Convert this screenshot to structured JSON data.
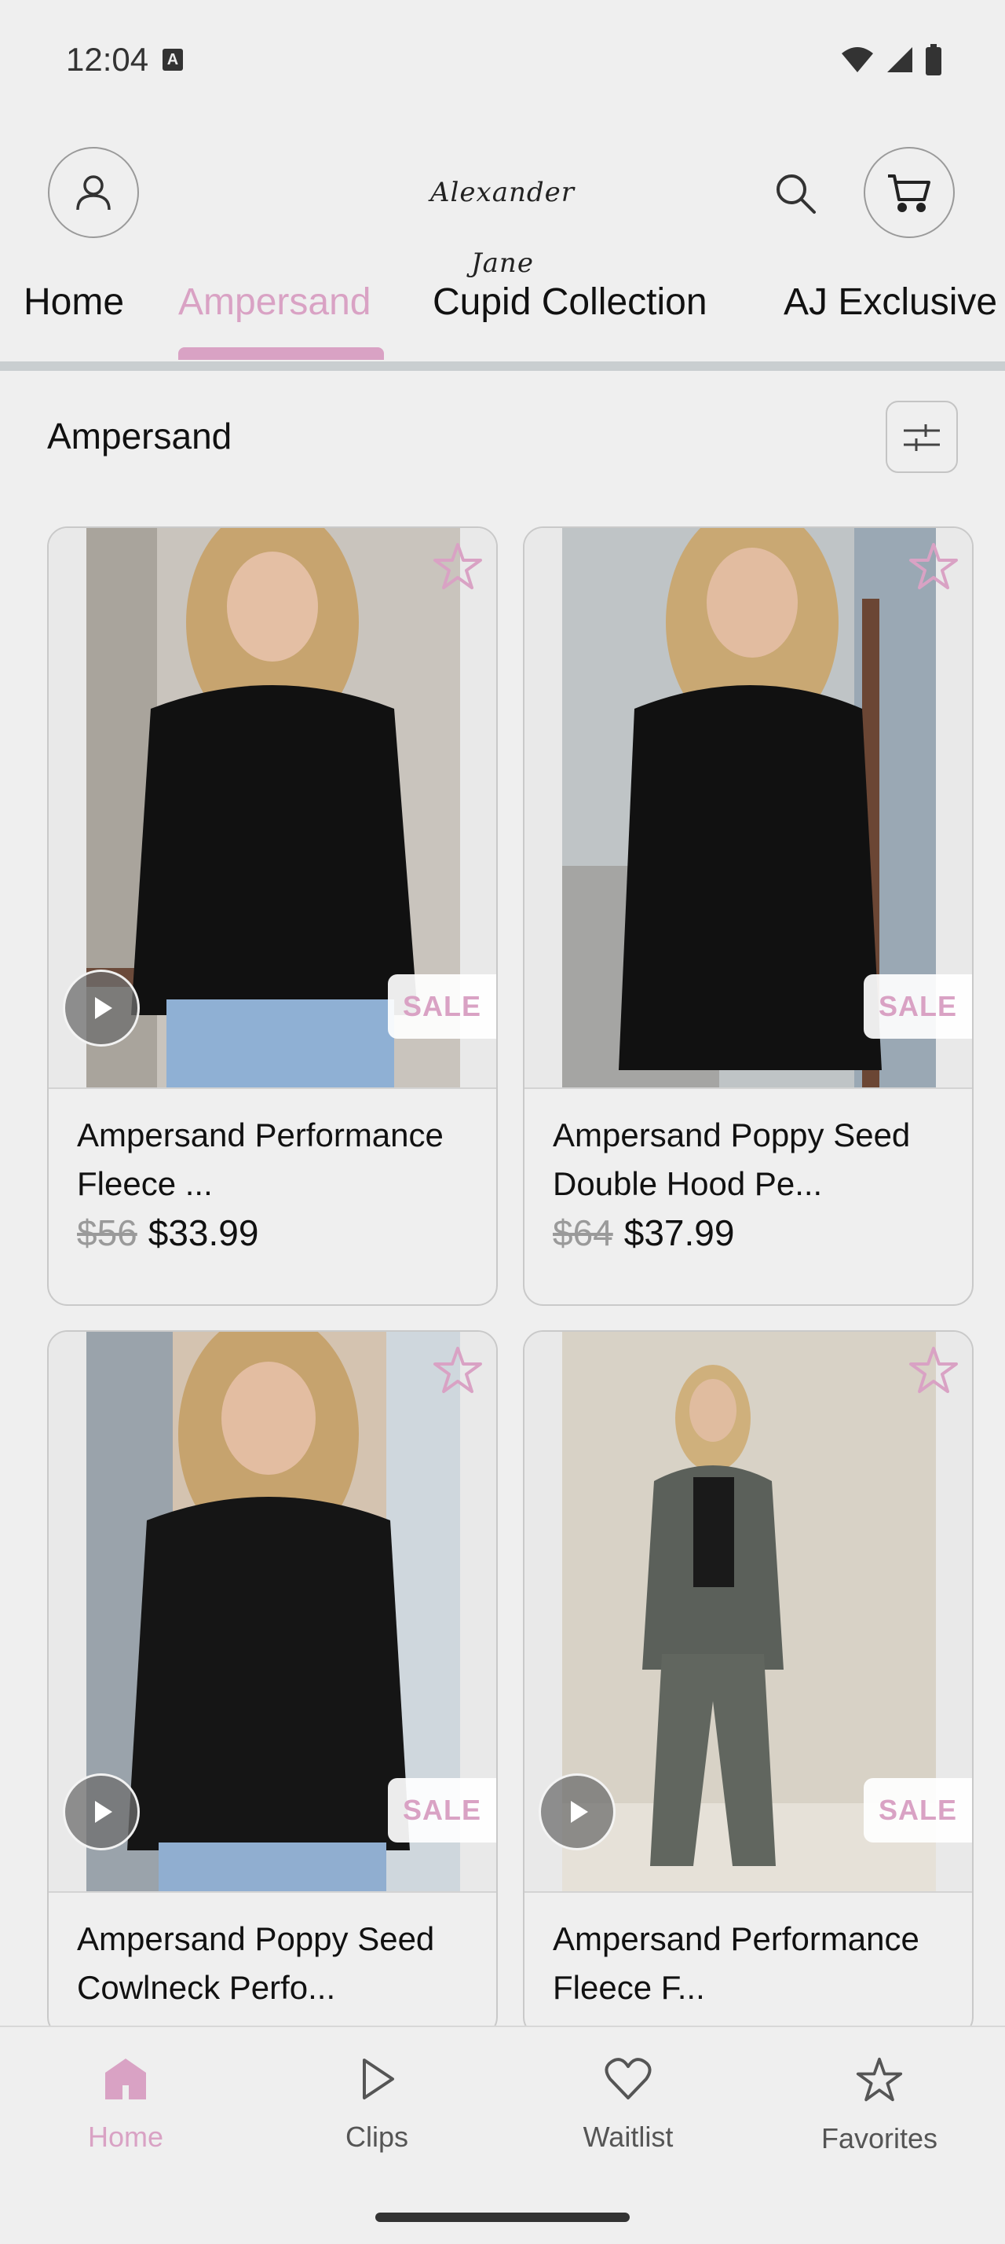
{
  "status_bar": {
    "time": "12:04",
    "notification_icon": "A"
  },
  "header": {
    "brand": "Alexander Jane",
    "profile_icon": "person-icon",
    "search_icon": "search-icon",
    "cart_icon": "cart-icon"
  },
  "tabs": [
    {
      "label": "Home",
      "active": false
    },
    {
      "label": "Ampersand",
      "active": true
    },
    {
      "label": "Cupid Collection",
      "active": false
    },
    {
      "label": "AJ Exclusive",
      "active": false
    }
  ],
  "section": {
    "title": "Ampersand",
    "filter_icon": "filter-sliders-icon"
  },
  "products": [
    {
      "name": "Ampersand Performance Fleece ...",
      "old_price": "$56",
      "price": "$33.99",
      "badge": "SALE",
      "has_video": true,
      "top_color": "#111111"
    },
    {
      "name": "Ampersand Poppy Seed Double Hood Pe...",
      "old_price": "$64",
      "price": "$37.99",
      "badge": "SALE",
      "has_video": false,
      "top_color": "#111111"
    },
    {
      "name": "Ampersand Poppy Seed Cowlneck Perfo...",
      "badge": "SALE",
      "has_video": true,
      "top_color": "#151515"
    },
    {
      "name": "Ampersand Performance Fleece F...",
      "badge": "SALE",
      "has_video": true,
      "top_color": "#5b605a"
    }
  ],
  "bottom_nav": [
    {
      "label": "Home",
      "icon": "home-icon",
      "active": true
    },
    {
      "label": "Clips",
      "icon": "play-icon",
      "active": false
    },
    {
      "label": "Waitlist",
      "icon": "heart-icon",
      "active": false
    },
    {
      "label": "Favorites",
      "icon": "star-icon",
      "active": false
    }
  ],
  "colors": {
    "accent": "#d9a2c4",
    "background": "#efefef"
  }
}
